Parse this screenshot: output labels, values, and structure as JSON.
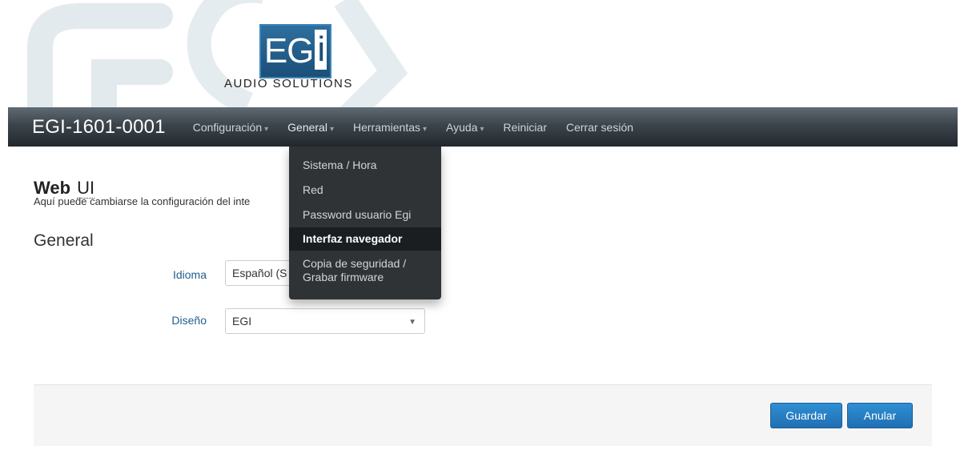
{
  "logo": {
    "title": "EGi",
    "subtitle": "AUDIO SOLUTIONS"
  },
  "navbar": {
    "brand": "EGI-1601-0001",
    "items": [
      {
        "label": "Configuración",
        "has_caret": true
      },
      {
        "label": "General",
        "has_caret": true
      },
      {
        "label": "Herramientas",
        "has_caret": true
      },
      {
        "label": "Ayuda",
        "has_caret": true
      },
      {
        "label": "Reiniciar",
        "has_caret": false
      },
      {
        "label": "Cerrar sesión",
        "has_caret": false
      }
    ],
    "caret": "▾"
  },
  "dropdown": {
    "items": [
      {
        "label": "Sistema / Hora"
      },
      {
        "label": "Red"
      },
      {
        "label": "Password usuario Egi"
      },
      {
        "label": "Interfaz navegador",
        "active": true
      },
      {
        "label_line1": "Copia de seguridad /",
        "label_line2": "Grabar firmware"
      }
    ]
  },
  "content": {
    "title_bold": "Web",
    "title_abbr": "UI",
    "subtitle": "Aquí puede cambiarse la configuración del inte",
    "section": "General",
    "fields": [
      {
        "label": "Idioma",
        "value": "Español (S"
      },
      {
        "label": "Diseño",
        "value": "EGI"
      }
    ],
    "select_arrow": "▼"
  },
  "actions": {
    "save": "Guardar",
    "cancel": "Anular"
  },
  "colors": {
    "navbar_dark": "#22282d",
    "dropdown_bg": "#2f3336",
    "label_blue": "#1f5d8f",
    "button_blue": "#1f6fb2"
  }
}
